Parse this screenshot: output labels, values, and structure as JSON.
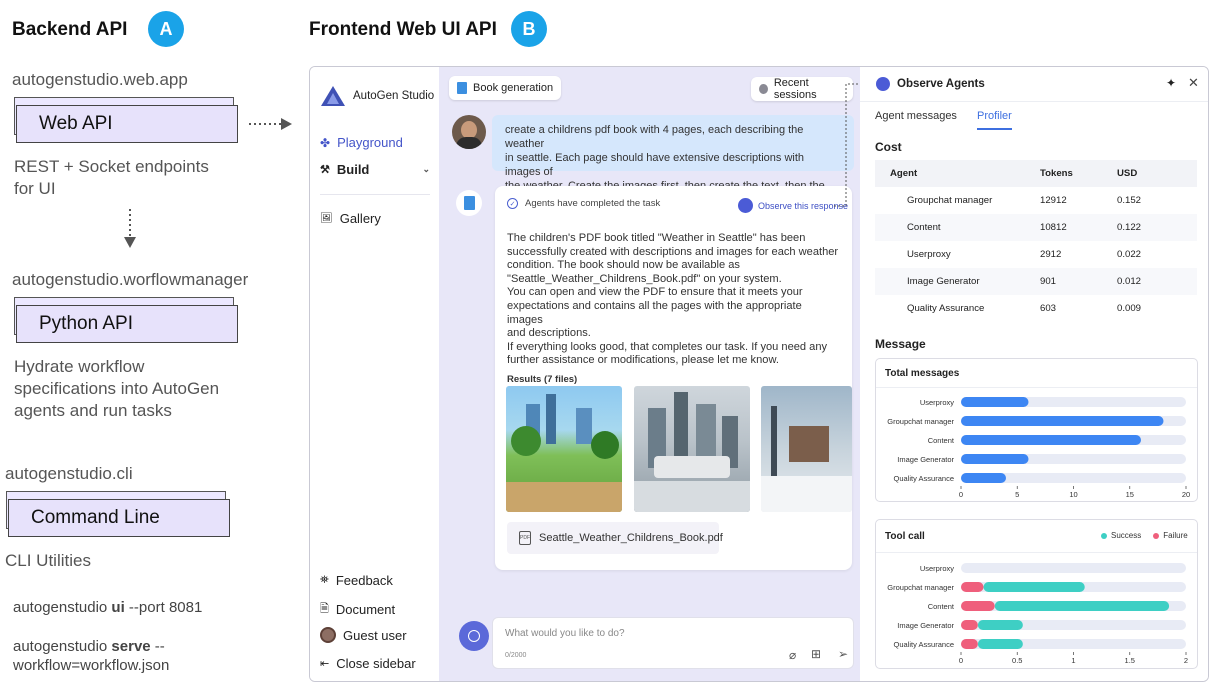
{
  "left": {
    "backend_title": "Backend API",
    "badge_a": "A",
    "web_app_label": "autogenstudio.web.app",
    "web_api_box": "Web API",
    "web_api_desc": [
      "REST + Socket endpoints",
      "for UI"
    ],
    "workflow_label": "autogenstudio.worflowmanager",
    "python_api_box": "Python  API",
    "python_api_desc": [
      "Hydrate workflow",
      "specifications into AutoGen",
      "agents and run tasks"
    ],
    "cli_label": "autogenstudio.cli",
    "cli_box": "Command Line",
    "cli_desc": "CLI Utilities",
    "cmd1": {
      "pre": "autogenstudio ",
      "bold": "ui",
      "post": " --port 8081"
    },
    "cmd2": {
      "pre": "autogenstudio ",
      "bold": "serve",
      "post": " --",
      "line2": "workflow=workflow.json"
    }
  },
  "frontend_title": "Frontend Web UI API",
  "badge_b": "B",
  "sidebar": {
    "app_name": "AutoGen Studio",
    "playground": "Playground",
    "build": "Build",
    "gallery": "Gallery",
    "feedback": "Feedback",
    "document": "Document",
    "guest_user": "Guest user",
    "close_sidebar": "Close sidebar"
  },
  "chat": {
    "session_title": "Book generation",
    "recent_sessions": "Recent sessions",
    "user_message": [
      "create a childrens pdf book with 4 pages, each describing the weather",
      "in seattle. Each page should have extensive descriptions with images of",
      "the weather. Create the images first, then create the text, then the pdf."
    ],
    "status": "Agents have completed the task",
    "observe": "Observe this response",
    "response": [
      "The children's PDF book titled \"Weather in Seattle\" has been",
      "successfully created with descriptions and images for each weather",
      "condition. The book should now be available as",
      "\"Seattle_Weather_Childrens_Book.pdf\" on your system.",
      "You can open and view the PDF to ensure that it meets your",
      "expectations and contains all the pages with the appropriate images",
      "and descriptions.",
      "If everything looks good, that completes our task. If you need any",
      "further assistance or modifications, please let me know."
    ],
    "results_label": "Results (7 files)",
    "pdf_name": "Seattle_Weather_Childrens_Book.pdf",
    "input_placeholder": "What would you like to do?",
    "char_count": "0/2000"
  },
  "panel": {
    "title": "Observe Agents",
    "tab_agent_messages": "Agent messages",
    "tab_profiler": "Profiler",
    "cost_heading": "Cost",
    "cost_headers": [
      "Agent",
      "Tokens",
      "USD"
    ],
    "cost_rows": [
      [
        "Groupchat manager",
        "12912",
        "0.152"
      ],
      [
        "Content",
        "10812",
        "0.122"
      ],
      [
        "Userproxy",
        "2912",
        "0.022"
      ],
      [
        "Image Generator",
        "901",
        "0.012"
      ],
      [
        "Quality Assurance",
        "603",
        "0.009"
      ]
    ],
    "message_heading": "Message"
  },
  "chart_data": [
    {
      "type": "bar",
      "orientation": "horizontal",
      "title": "Total messages",
      "categories": [
        "Userproxy",
        "Groupchat manager",
        "Content",
        "Image Generator",
        "Quality Assurance"
      ],
      "values": [
        6,
        18,
        16,
        6,
        4
      ],
      "xlim": [
        0,
        20
      ],
      "xticks": [
        "0",
        "5",
        "10",
        "15",
        "20"
      ],
      "color": "#3d86f3",
      "track_color": "#e8ebf5"
    },
    {
      "type": "bar",
      "orientation": "horizontal",
      "stacked": true,
      "title": "Tool call",
      "categories": [
        "Userproxy",
        "Groupchat manager",
        "Content",
        "Image Generator",
        "Quality Assurance"
      ],
      "series": [
        {
          "name": "Failure",
          "values": [
            0,
            0.2,
            0.3,
            0.15,
            0.15
          ],
          "color": "#ef5f7c"
        },
        {
          "name": "Success",
          "values": [
            0,
            0.9,
            1.55,
            0.4,
            0.4
          ],
          "color": "#3ecfc4"
        }
      ],
      "legend": [
        "Success",
        "Failure"
      ],
      "xlim": [
        0,
        2
      ],
      "xticks": [
        "0",
        "0.5",
        "1",
        "1.5",
        "2"
      ],
      "track_color": "#e8ebf5"
    }
  ]
}
